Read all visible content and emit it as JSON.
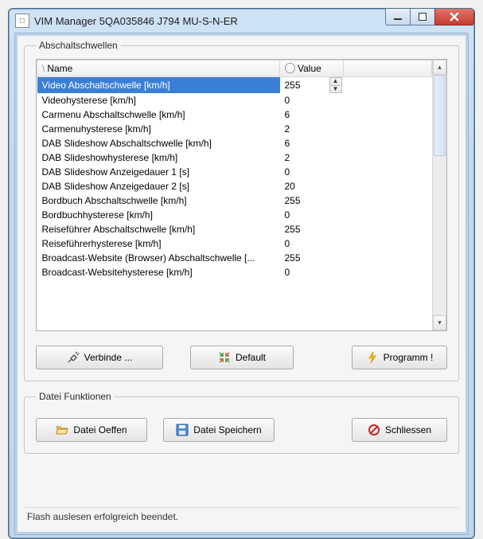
{
  "window": {
    "title": "VIM Manager 5QA035846   J794  MU-S-N-ER",
    "sys_icon_text": "□"
  },
  "group_thresholds": {
    "legend": "Abschaltschwellen",
    "columns": {
      "name": "Name",
      "value": "Value"
    },
    "rows": [
      {
        "name": "Video Abschaltschwelle [km/h]",
        "value": "255",
        "selected": true,
        "editing": true
      },
      {
        "name": "Videohysterese [km/h]",
        "value": "0"
      },
      {
        "name": "Carmenu Abschaltschwelle [km/h]",
        "value": "6"
      },
      {
        "name": "Carmenuhysterese [km/h]",
        "value": "2"
      },
      {
        "name": "DAB Slideshow Abschaltschwelle [km/h]",
        "value": "6"
      },
      {
        "name": "DAB Slideshowhysterese [km/h]",
        "value": "2"
      },
      {
        "name": "DAB Slideshow Anzeigedauer 1 [s]",
        "value": "0"
      },
      {
        "name": "DAB Slideshow Anzeigedauer 2 [s]",
        "value": "20"
      },
      {
        "name": "Bordbuch Abschaltschwelle [km/h]",
        "value": "255"
      },
      {
        "name": "Bordbuchhysterese [km/h]",
        "value": "0"
      },
      {
        "name": "Reiseführer Abschaltschwelle [km/h]",
        "value": "255"
      },
      {
        "name": "Reiseführerhysterese [km/h]",
        "value": "0"
      },
      {
        "name": "Broadcast-Website (Browser) Abschaltschwelle [...",
        "value": "255"
      },
      {
        "name": "Broadcast-Websitehysterese [km/h]",
        "value": "0"
      }
    ],
    "buttons": {
      "connect": "Verbinde ...",
      "default": "Default",
      "program": "Programm !"
    }
  },
  "group_file": {
    "legend": "Datei Funktionen",
    "buttons": {
      "open": "Datei Oeffen",
      "save": "Datei Speichern",
      "close": "Schliessen"
    }
  },
  "status": "Flash auslesen erfolgreich beendet."
}
